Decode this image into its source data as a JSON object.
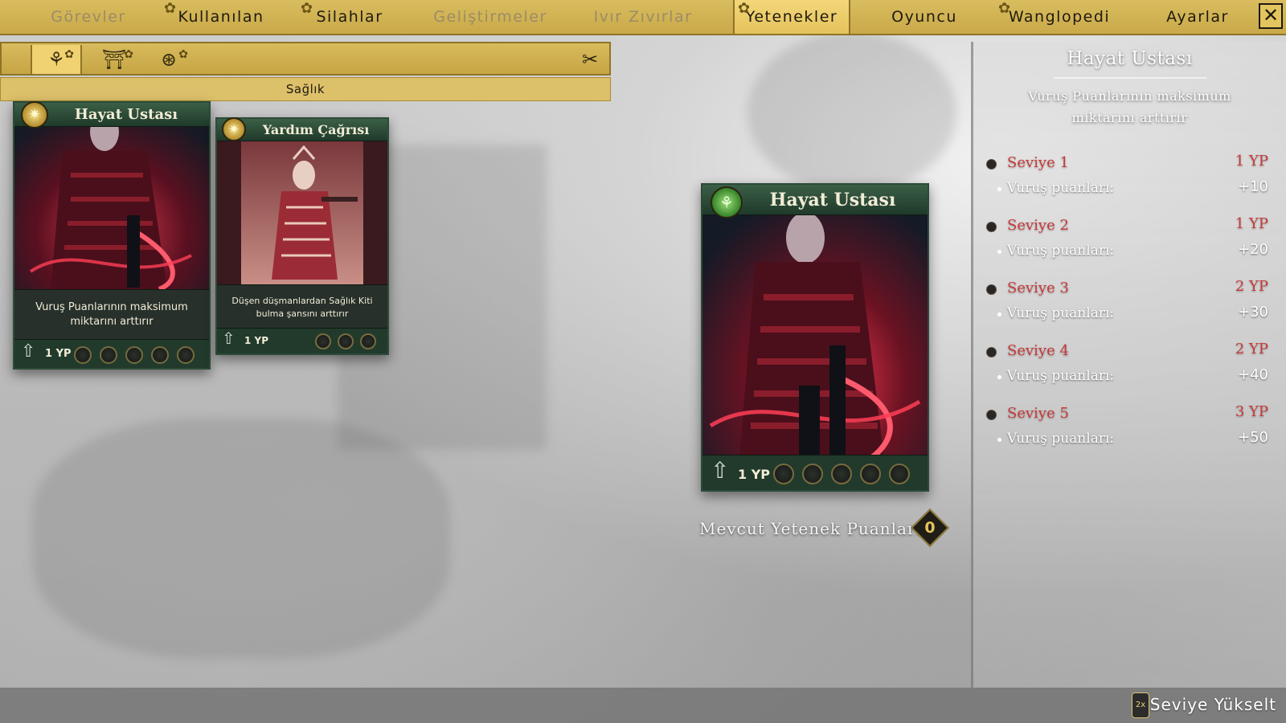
{
  "nav": {
    "tabs": [
      {
        "label": "Görevler",
        "state": "dim",
        "gear": false
      },
      {
        "label": "Kullanılan",
        "state": "normal",
        "gear": true
      },
      {
        "label": "Silahlar",
        "state": "normal",
        "gear": true
      },
      {
        "label": "Geliştirmeler",
        "state": "dim",
        "gear": false
      },
      {
        "label": "Ivır Zıvırlar",
        "state": "dim",
        "gear": false
      },
      {
        "label": "Yetenekler",
        "state": "active",
        "gear": true
      },
      {
        "label": "Oyuncu",
        "state": "normal",
        "gear": false
      },
      {
        "label": "Wanglopedi",
        "state": "normal",
        "gear": true
      },
      {
        "label": "Ayarlar",
        "state": "normal",
        "gear": false
      }
    ],
    "close_icon": "close-icon",
    "close_glyph": "✕"
  },
  "toolbar": {
    "icons": [
      {
        "name": "bonsai-icon",
        "glyph": "⚘",
        "selected": true
      },
      {
        "name": "torii-gate-icon",
        "glyph": "⛩",
        "selected": false
      },
      {
        "name": "lantern-icon",
        "glyph": "⊛",
        "selected": false
      }
    ],
    "unequip_icon": "unequip-icon",
    "unequip_glyph": "✂"
  },
  "category": "Sağlık",
  "cards": [
    {
      "title": "Hayat Ustası",
      "description": "Vuruş Puanlarının maksimum miktarını arttırır",
      "cost": "1 YP",
      "pips": 5,
      "badge_icon": "sun-emblem-icon",
      "art": "red-armored-warrior"
    },
    {
      "title": "Yardım Çağrısı",
      "description": "Düşen düşmanlardan Sağlık Kiti bulma şansını arttırır",
      "cost": "1 YP",
      "pips": 3,
      "badge_icon": "sun-emblem-icon",
      "art": "robed-priest"
    }
  ],
  "preview": {
    "title": "Hayat Ustası",
    "cost": "1 YP",
    "pips": 5,
    "badge_icon": "bonsai-emblem-icon"
  },
  "points": {
    "label": "Mevcut Yetenek Puanları",
    "value": "0"
  },
  "detail": {
    "title": "Hayat Ustası",
    "description": "Vuruş Puanlarının maksimum miktarını arttırır",
    "levels": [
      {
        "name": "Seviye 1",
        "cost": "1 YP",
        "stat_label": "Vuruş puanları:",
        "stat_value": "+10"
      },
      {
        "name": "Seviye 2",
        "cost": "1 YP",
        "stat_label": "Vuruş puanları:",
        "stat_value": "+20"
      },
      {
        "name": "Seviye 3",
        "cost": "2 YP",
        "stat_label": "Vuruş puanları:",
        "stat_value": "+30"
      },
      {
        "name": "Seviye 4",
        "cost": "2 YP",
        "stat_label": "Vuruş puanları:",
        "stat_value": "+40"
      },
      {
        "name": "Seviye 5",
        "cost": "3 YP",
        "stat_label": "Vuruş puanları:",
        "stat_value": "+50"
      }
    ],
    "locked_color": "#c83a3a"
  },
  "bottom": {
    "controller_icon": "gamepad-button-icon",
    "controller_glyph": "2x",
    "upgrade_label": "Seviye Yükselt"
  },
  "colors": {
    "nav_gold": "#d9bd5e",
    "card_green": "#213a2b",
    "art_red": "#c4233a"
  }
}
